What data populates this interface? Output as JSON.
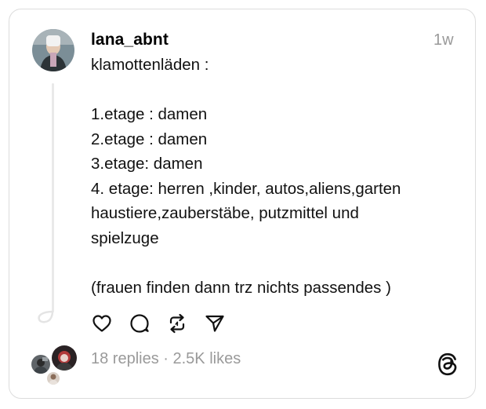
{
  "post": {
    "username": "lana_abnt",
    "time": "1w",
    "lines": [
      "klamottenläden :",
      "",
      "1.etage : damen",
      "2.etage : damen",
      "3.etage: damen",
      "4. etage: herren ,kinder, autos,aliens,garten",
      "haustiere,zauberstäbe, putzmittel und",
      "spielzuge",
      "",
      "(frauen finden dann trz nichts passendes )"
    ],
    "stats": "18 replies · 2.5K likes"
  },
  "icons": {
    "like": "heart-icon",
    "reply": "comment-icon",
    "repost": "repost-icon",
    "share": "send-icon",
    "logo": "threads-logo-icon"
  },
  "colors": {
    "muted": "#9a9a9a",
    "border": "#dcdcdc"
  }
}
